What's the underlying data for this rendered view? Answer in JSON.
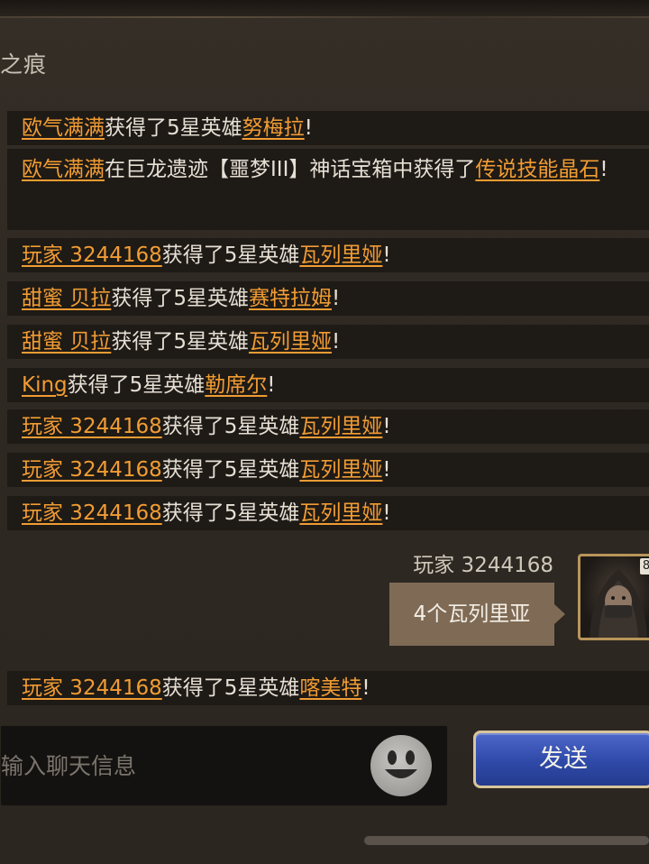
{
  "header": {
    "title": "之痕"
  },
  "messages": [
    {
      "name": "欧气满满",
      "text1": "获得了5星英雄",
      "item": "努梅拉",
      "end": "!"
    },
    {
      "name": "欧气满满",
      "text1": "在巨龙遗迹【噩梦III】神话宝箱中获得了",
      "item": "传说技能晶石",
      "end": "!"
    },
    {
      "name": "玩家 3244168",
      "text1": "获得了5星英雄",
      "item": "瓦列里娅",
      "end": "!"
    },
    {
      "name": "甜蜜 贝拉",
      "text1": "获得了5星英雄",
      "item": "赛特拉姆",
      "end": "!"
    },
    {
      "name": "甜蜜 贝拉",
      "text1": "获得了5星英雄",
      "item": "瓦列里娅",
      "end": "!"
    },
    {
      "name": "King",
      "text1": "获得了5星英雄",
      "item": "勒席尔",
      "end": "!"
    },
    {
      "name": "玩家 3244168",
      "text1": "获得了5星英雄",
      "item": "瓦列里娅",
      "end": "!"
    },
    {
      "name": "玩家 3244168",
      "text1": "获得了5星英雄",
      "item": "瓦列里娅",
      "end": "!"
    },
    {
      "name": "玩家 3244168",
      "text1": "获得了5星英雄",
      "item": "瓦列里娅",
      "end": "!"
    },
    {
      "name": "玩家 3244168",
      "text1": "获得了5星英雄",
      "item": "喀美特",
      "end": "!"
    }
  ],
  "chat": {
    "user": "玩家 3244168",
    "text": "4个瓦列里亚",
    "avatar_badge": "8"
  },
  "input": {
    "placeholder": "输入聊天信息"
  },
  "send": {
    "label": "发送"
  },
  "icons": {
    "emoji": "smiley-face-icon",
    "avatar": "hooded-hero-portrait"
  },
  "colors": {
    "name_link": "#f19c33",
    "send_button": "#2f49a8"
  }
}
